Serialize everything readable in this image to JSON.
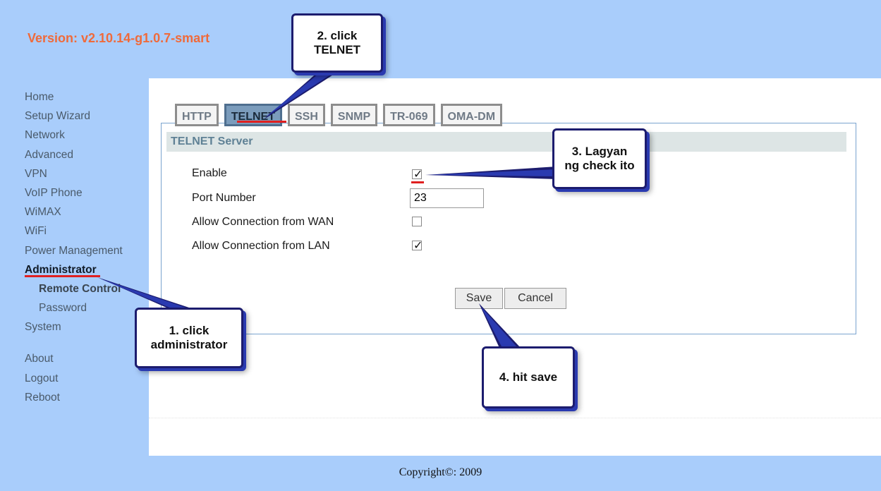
{
  "version": "Version: v2.10.14-g1.0.7-smart",
  "sidebar": {
    "items": [
      {
        "label": "Home"
      },
      {
        "label": "Setup Wizard"
      },
      {
        "label": "Network"
      },
      {
        "label": "Advanced"
      },
      {
        "label": "VPN"
      },
      {
        "label": "VoIP Phone"
      },
      {
        "label": "WiMAX"
      },
      {
        "label": "WiFi"
      },
      {
        "label": "Power Management"
      },
      {
        "label": "Administrator"
      },
      {
        "label": "Remote Control"
      },
      {
        "label": "Password"
      },
      {
        "label": "System"
      }
    ],
    "bottom": [
      {
        "label": "About"
      },
      {
        "label": "Logout"
      },
      {
        "label": "Reboot"
      }
    ]
  },
  "tabs": [
    "HTTP",
    "TELNET",
    "SSH",
    "SNMP",
    "TR-069",
    "OMA-DM"
  ],
  "panel": {
    "title": "TELNET Server",
    "enable_label": "Enable",
    "enable_checked": true,
    "port_label": "Port Number",
    "port_value": "23",
    "wan_label": "Allow Connection from WAN",
    "wan_checked": false,
    "lan_label": "Allow Connection from LAN",
    "lan_checked": true
  },
  "buttons": {
    "save": "Save",
    "cancel": "Cancel"
  },
  "copyright": "Copyright©: 2009",
  "callouts": {
    "c1_line1": "1. click",
    "c1_line2": "administrator",
    "c2_line1": "2. click",
    "c2_line2": "TELNET",
    "c3_line1": "3. Lagyan",
    "c3_line2": "ng check ito",
    "c4": "4. hit save"
  },
  "colors": {
    "background": "#a9cdfb",
    "version": "#f06a3a",
    "annotation_underline": "#e02020",
    "callout_border": "#1c1c6e"
  }
}
